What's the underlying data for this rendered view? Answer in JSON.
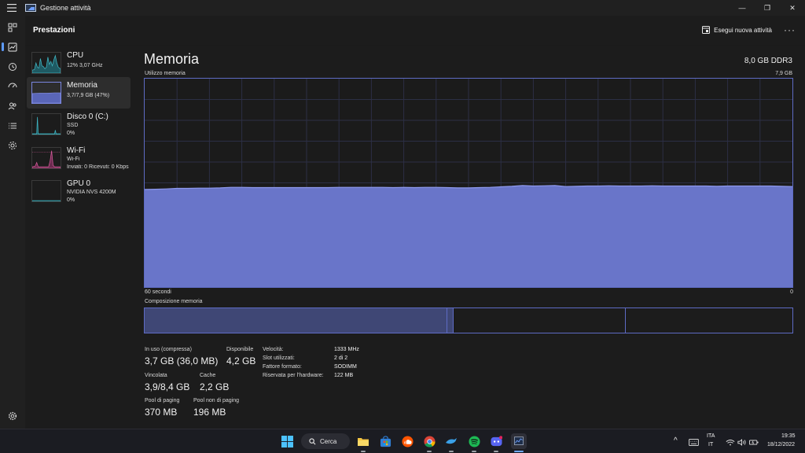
{
  "window": {
    "title": "Gestione attività"
  },
  "window_controls": {
    "minimize": "—",
    "maximize": "❐",
    "close": "✕"
  },
  "header": {
    "title": "Prestazioni",
    "run_task": "Esegui nuova attività",
    "more": "···"
  },
  "sidebar": {
    "items": [
      {
        "name": "CPU",
        "sub1": "12% 3,07 GHz",
        "sub2": "",
        "color": "#3fb5c2"
      },
      {
        "name": "Memoria",
        "sub1": "3,7/7,9 GB (47%)",
        "sub2": "",
        "color": "#7a86e0"
      },
      {
        "name": "Disco 0 (C:)",
        "sub1": "SSD",
        "sub2": "0%",
        "color": "#3fb5c2"
      },
      {
        "name": "Wi-Fi",
        "sub1": "Wi-Fi",
        "sub2": "Inviati: 0 Ricevuti: 0 Kbps",
        "color": "#d45a9a"
      },
      {
        "name": "GPU 0",
        "sub1": "NVIDIA NVS 4200M",
        "sub2": "0%",
        "color": "#3fb5c2"
      }
    ]
  },
  "main": {
    "title": "Memoria",
    "spec": "8,0 GB DDR3",
    "usage_label": "Utilizzo memoria",
    "max_label": "7,9 GB",
    "time_left": "60 secondi",
    "time_right": "0",
    "composition_label": "Composizione memoria",
    "composition": {
      "in_use_fraction": 0.466,
      "modified_fraction": 0.01,
      "standby_fraction": 0.266,
      "free_fraction": 0.258
    },
    "stats": {
      "in_use_label": "In uso (compressa)",
      "in_use_value": "3,7 GB (36,0 MB)",
      "available_label": "Disponibile",
      "available_value": "4,2 GB",
      "committed_label": "Vincolata",
      "committed_value": "3,9/8,4 GB",
      "cache_label": "Cache",
      "cache_value": "2,2 GB",
      "paged_label": "Pool di paging",
      "paged_value": "370 MB",
      "nonpaged_label": "Pool non di paging",
      "nonpaged_value": "196 MB"
    },
    "details": [
      {
        "key": "Velocità:",
        "value": "1333 MHz"
      },
      {
        "key": "Slot utilizzati:",
        "value": "2 di 2"
      },
      {
        "key": "Fattore formato:",
        "value": "SODIMM"
      },
      {
        "key": "Riservata per l'hardware:",
        "value": "122 MB"
      }
    ]
  },
  "chart_data": {
    "type": "area",
    "ylabel": "Utilizzo memoria",
    "xlabel": "",
    "ylim": [
      0,
      7.9
    ],
    "x_range_seconds": [
      60,
      0
    ],
    "series": [
      {
        "values": [
          3.7,
          3.71,
          3.72,
          3.74,
          3.74,
          3.75,
          3.75,
          3.76,
          3.78,
          3.78,
          3.77,
          3.77,
          3.77,
          3.77,
          3.77,
          3.77,
          3.77,
          3.77,
          3.78,
          3.78,
          3.78,
          3.78,
          3.78,
          3.77,
          3.78,
          3.77,
          3.78,
          3.78,
          3.77,
          3.76,
          3.76,
          3.77,
          3.78,
          3.8,
          3.82,
          3.85,
          3.83,
          3.84,
          3.85,
          3.81,
          3.82,
          3.83,
          3.83,
          3.84,
          3.83,
          3.83,
          3.83,
          3.84,
          3.83,
          3.83,
          3.83,
          3.83,
          3.83,
          3.82,
          3.83,
          3.83,
          3.83,
          3.83,
          3.83,
          3.82,
          3.81
        ]
      }
    ],
    "grid": true,
    "color": "#6975c9"
  },
  "taskbar": {
    "search_label": "Cerca",
    "apps": [
      "windows-start-icon",
      "search",
      "file-explorer-icon",
      "store-icon",
      "soundcloud-icon",
      "chrome-icon",
      "dolphin-icon",
      "spotify-icon",
      "discord-icon",
      "task-manager-icon"
    ],
    "lang_top": "ITA",
    "lang_bottom": "IT",
    "time": "19:35",
    "date": "18/12/2022",
    "chevron": "^"
  }
}
